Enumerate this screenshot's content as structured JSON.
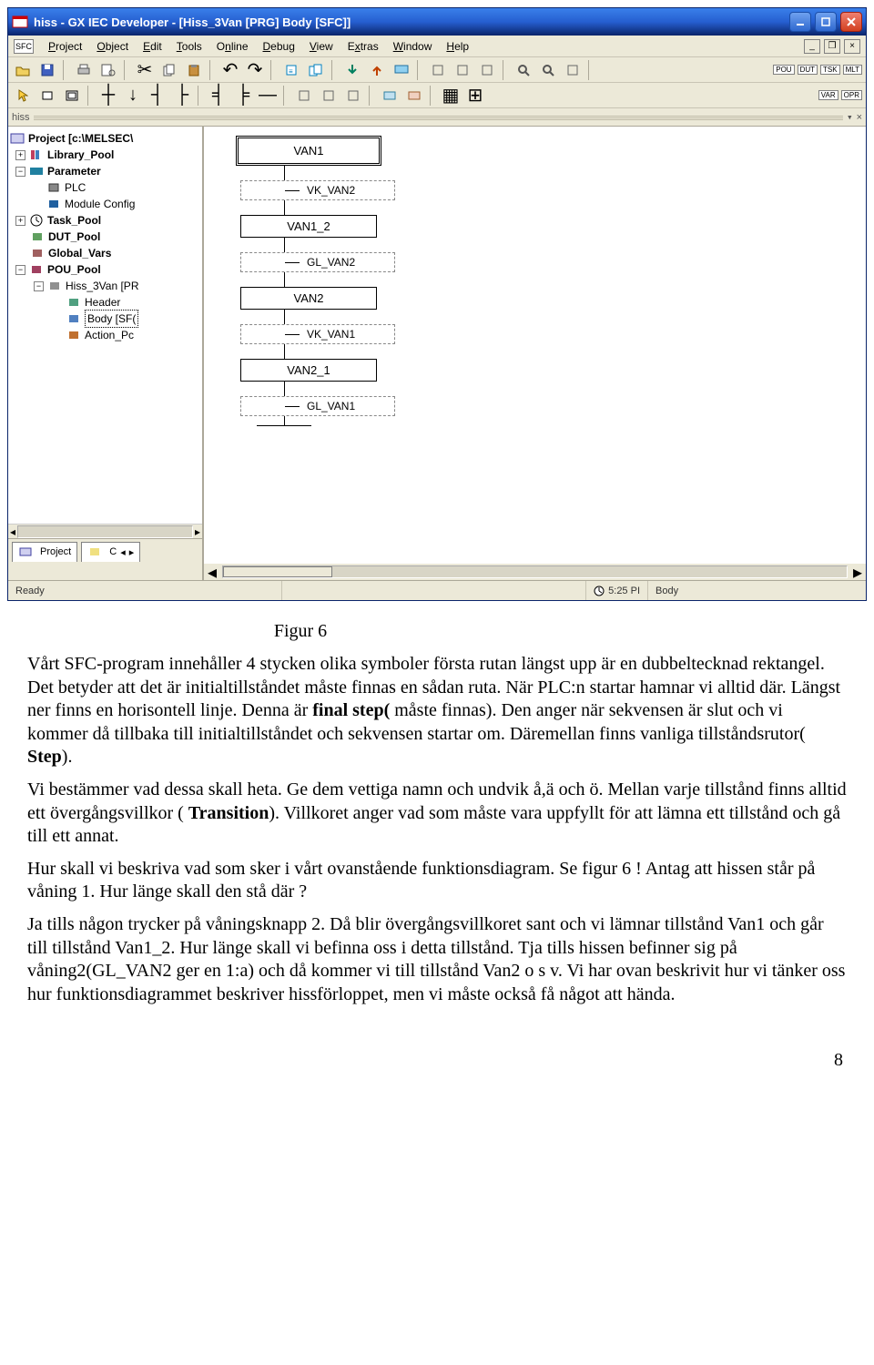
{
  "window": {
    "title": "hiss - GX IEC Developer - [Hiss_3Van [PRG] Body [SFC]]",
    "minimize": "_",
    "maximize": "□",
    "close": "X"
  },
  "menubar": {
    "items": [
      {
        "label": "Project",
        "hotkey": "P"
      },
      {
        "label": "Object",
        "hotkey": "O"
      },
      {
        "label": "Edit",
        "hotkey": "E"
      },
      {
        "label": "Tools",
        "hotkey": "T"
      },
      {
        "label": "Online",
        "hotkey": "O"
      },
      {
        "label": "Debug",
        "hotkey": "D"
      },
      {
        "label": "View",
        "hotkey": "V"
      },
      {
        "label": "Extras",
        "hotkey": "E"
      },
      {
        "label": "Window",
        "hotkey": "W"
      },
      {
        "label": "Help",
        "hotkey": "H"
      }
    ],
    "sfc_tag": "SFC"
  },
  "indicators": {
    "pou": "POU",
    "dut": "DUT",
    "tsk": "TSK",
    "mlt": "MLT",
    "var": "VAR",
    "opr": "OPR"
  },
  "panel": {
    "name": "hiss",
    "close": "×"
  },
  "tree": {
    "root": "Project [c:\\MELSEC\\",
    "nodes": [
      {
        "label": "Library_Pool",
        "bold": true
      },
      {
        "label": "Parameter",
        "bold": true
      },
      {
        "label": "PLC",
        "bold": false,
        "indent": 1
      },
      {
        "label": "Module Config",
        "bold": false,
        "indent": 1
      },
      {
        "label": "Task_Pool",
        "bold": true
      },
      {
        "label": "DUT_Pool",
        "bold": true
      },
      {
        "label": "Global_Vars",
        "bold": true
      },
      {
        "label": "POU_Pool",
        "bold": true
      },
      {
        "label": "Hiss_3Van [PR",
        "indent": 1
      },
      {
        "label": "Header",
        "indent": 2
      },
      {
        "label": "Body [SF(",
        "indent": 2,
        "selected": true
      },
      {
        "label": "Action_Pc",
        "indent": 2
      }
    ],
    "tabs": {
      "project": "Project",
      "c": "C"
    }
  },
  "sfc": {
    "elements": [
      {
        "type": "initial",
        "label": "VAN1"
      },
      {
        "type": "trans",
        "label": "VK_VAN2"
      },
      {
        "type": "step",
        "label": "VAN1_2"
      },
      {
        "type": "trans",
        "label": "GL_VAN2"
      },
      {
        "type": "step",
        "label": "VAN2"
      },
      {
        "type": "trans",
        "label": "VK_VAN1"
      },
      {
        "type": "step",
        "label": "VAN2_1"
      },
      {
        "type": "trans",
        "label": "GL_VAN1"
      }
    ]
  },
  "status": {
    "ready": "Ready",
    "time": "5:25 PI",
    "mode": "Body"
  },
  "figure_caption": "Figur 6",
  "body_text": {
    "p1": "Vårt SFC-program innehåller 4 stycken olika symboler första rutan längst upp är en dubbeltecknad rektangel. Det betyder att det är initialtillståndet  måste finnas en sådan ruta. När PLC:n startar hamnar vi alltid där. Längst ner finns en horisontell linje. Denna är ",
    "p1b": "final step(",
    "p1c": " måste finnas). Den anger när sekvensen är slut och vi kommer då tillbaka till initialtillståndet och sekvensen startar om. Däremellan finns vanliga tillståndsrutor( ",
    "p1d": "Step",
    "p1e": ").",
    "p2": "Vi bestämmer vad dessa skall heta. Ge dem vettiga namn och undvik å,ä och ö. Mellan varje tillstånd finns alltid ett övergångsvillkor ( ",
    "p2b": "Transition",
    "p2c": "). Villkoret anger vad som måste vara uppfyllt för att lämna ett tillstånd och gå till ett annat.",
    "p3": "Hur skall vi beskriva vad som sker i vårt ovanstående funktionsdiagram. Se figur 6 ! Antag att hissen står på våning 1. Hur länge skall den stå där ?",
    "p4": "Ja tills någon trycker på våningsknapp 2. Då blir övergångsvillkoret sant och vi lämnar tillstånd Van1 och går till tillstånd Van1_2. Hur länge skall vi befinna oss i detta tillstånd. Tja tills hissen befinner sig på våning2(GL_VAN2 ger en 1:a) och då kommer vi till tillstånd Van2 o s v. Vi har ovan beskrivit hur vi tänker oss hur funktionsdiagrammet beskriver hissförloppet, men vi måste också få något att hända."
  },
  "page_number": "8"
}
